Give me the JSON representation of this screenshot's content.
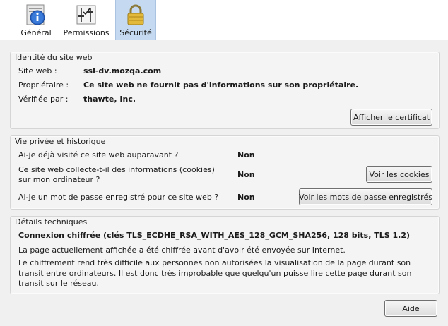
{
  "tabs": [
    {
      "label": "Général",
      "icon": "info-icon",
      "selected": false
    },
    {
      "label": "Permissions",
      "icon": "permissions-icon",
      "selected": false
    },
    {
      "label": "Sécurité",
      "icon": "padlock-icon",
      "selected": true
    }
  ],
  "identity": {
    "title": "Identité du site web",
    "site_label": "Site web :",
    "site_value": "ssl-dv.mozqa.com",
    "owner_label": "Propriétaire :",
    "owner_value": "Ce site web ne fournit pas d'informations sur son propriétaire.",
    "verified_label": "Vérifiée par :",
    "verified_value": "thawte, Inc.",
    "view_cert_button": "Afficher le certificat"
  },
  "privacy": {
    "title": "Vie privée et historique",
    "q1": "Ai-je déjà visité ce site web auparavant ?",
    "a1": "Non",
    "q2": "Ce site web collecte-t-il des informations (cookies) sur mon ordinateur ?",
    "a2": "Non",
    "cookies_button": "Voir les cookies",
    "q3": "Ai-je un mot de passe enregistré pour ce site web ?",
    "a3": "Non",
    "passwords_button": "Voir les mots de passe enregistrés"
  },
  "tech": {
    "title": "Détails techniques",
    "connection": "Connexion chiffrée (clés TLS_ECDHE_RSA_WITH_AES_128_GCM_SHA256, 128 bits, TLS 1.2)",
    "para1": "La page actuellement affichée a été chiffrée avant d'avoir été envoyée sur Internet.",
    "para2": "Le chiffrement rend très difficile aux personnes non autorisées la visualisation de la page durant son transit entre ordinateurs. Il est donc très improbable que quelqu'un puisse lire cette page durant son transit sur le réseau."
  },
  "help_button": "Aide",
  "colors": {
    "selected_tab": "#c5daf0",
    "panel": "#f0f0f0"
  }
}
